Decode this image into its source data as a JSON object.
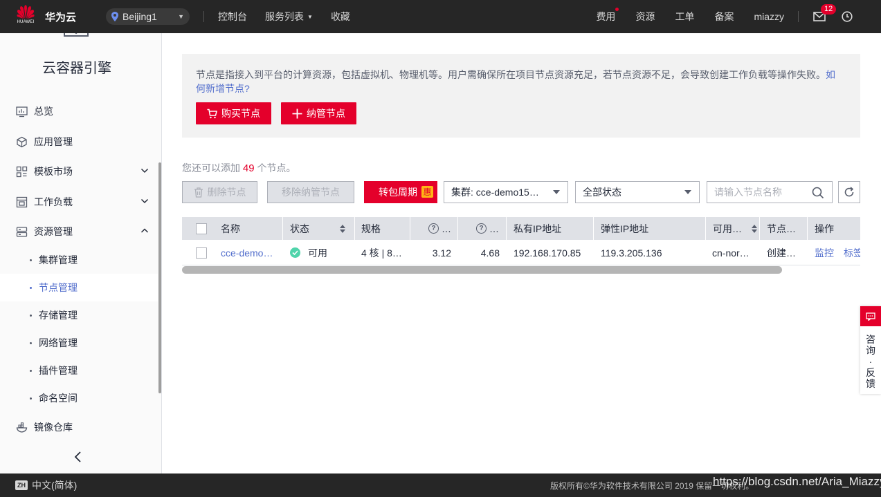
{
  "topbar": {
    "brand": "华为云",
    "brand_sub": "HUAWEI",
    "region": "Beijing1",
    "nav": [
      "控制台",
      "服务列表",
      "收藏"
    ],
    "right_links": [
      "费用",
      "资源",
      "工单",
      "备案",
      "miazzy"
    ],
    "mail_badge": "12"
  },
  "sidebar": {
    "title": "云容器引擎",
    "items": [
      {
        "label": "总览",
        "icon": "monitor-chart-icon"
      },
      {
        "label": "应用管理",
        "icon": "cube-icon"
      },
      {
        "label": "模板市场",
        "icon": "grid-icon"
      },
      {
        "label": "工作负载",
        "icon": "workload-icon"
      },
      {
        "label": "资源管理",
        "icon": "server-icon"
      },
      {
        "label": "镜像仓库",
        "icon": "container-icon"
      }
    ],
    "sub_items": [
      "集群管理",
      "节点管理",
      "存储管理",
      "网络管理",
      "插件管理",
      "命名空间"
    ],
    "active_sub": "节点管理"
  },
  "notice": {
    "text": "节点是指接入到平台的计算资源，包括虚拟机、物理机等。用户需确保所在项目节点资源充足，若节点资源不足，会导致创建工作负载等操作失败。",
    "link": "如何新增节点?",
    "buy_button": "购买节点",
    "manage_button": "纳管节点"
  },
  "quota": {
    "prefix": "您还可以添加",
    "count": "49",
    "suffix": "个节点。"
  },
  "toolbar": {
    "delete": "删除节点",
    "remove": "移除纳管节点",
    "period": "转包周期",
    "period_badge": "惠",
    "cluster_select": "集群:  cce-demo15…",
    "status_select": "全部状态",
    "search_placeholder": "请输入节点名称"
  },
  "table": {
    "headers": [
      "名称",
      "状态",
      "规格",
      "…",
      "…",
      "私有IP地址",
      "弹性IP地址",
      "可用…",
      "节点…",
      "操作"
    ],
    "rows": [
      {
        "name": "cce-demo…",
        "status": "可用",
        "spec": "4 核 | 8…",
        "col4": "3.12",
        "col5": "4.68",
        "private_ip": "192.168.170.85",
        "eip": "119.3.205.136",
        "az": "cn-nor…",
        "node_status": "创建…",
        "actions": [
          "监控",
          "标签"
        ]
      }
    ]
  },
  "feedback": {
    "text": [
      "咨",
      "询",
      "·",
      "反",
      "馈"
    ]
  },
  "footer": {
    "lang_badge": "ZH",
    "lang": "中文(简体)",
    "copyright": "版权所有©华为软件技术有限公司 2019 保留一切权利。",
    "watermark": "https://blog.csdn.net/Aria_Miazzy"
  },
  "colors": {
    "brand_red": "#e4002b",
    "link_blue": "#526ecc",
    "status_green": "#50d4ab"
  }
}
